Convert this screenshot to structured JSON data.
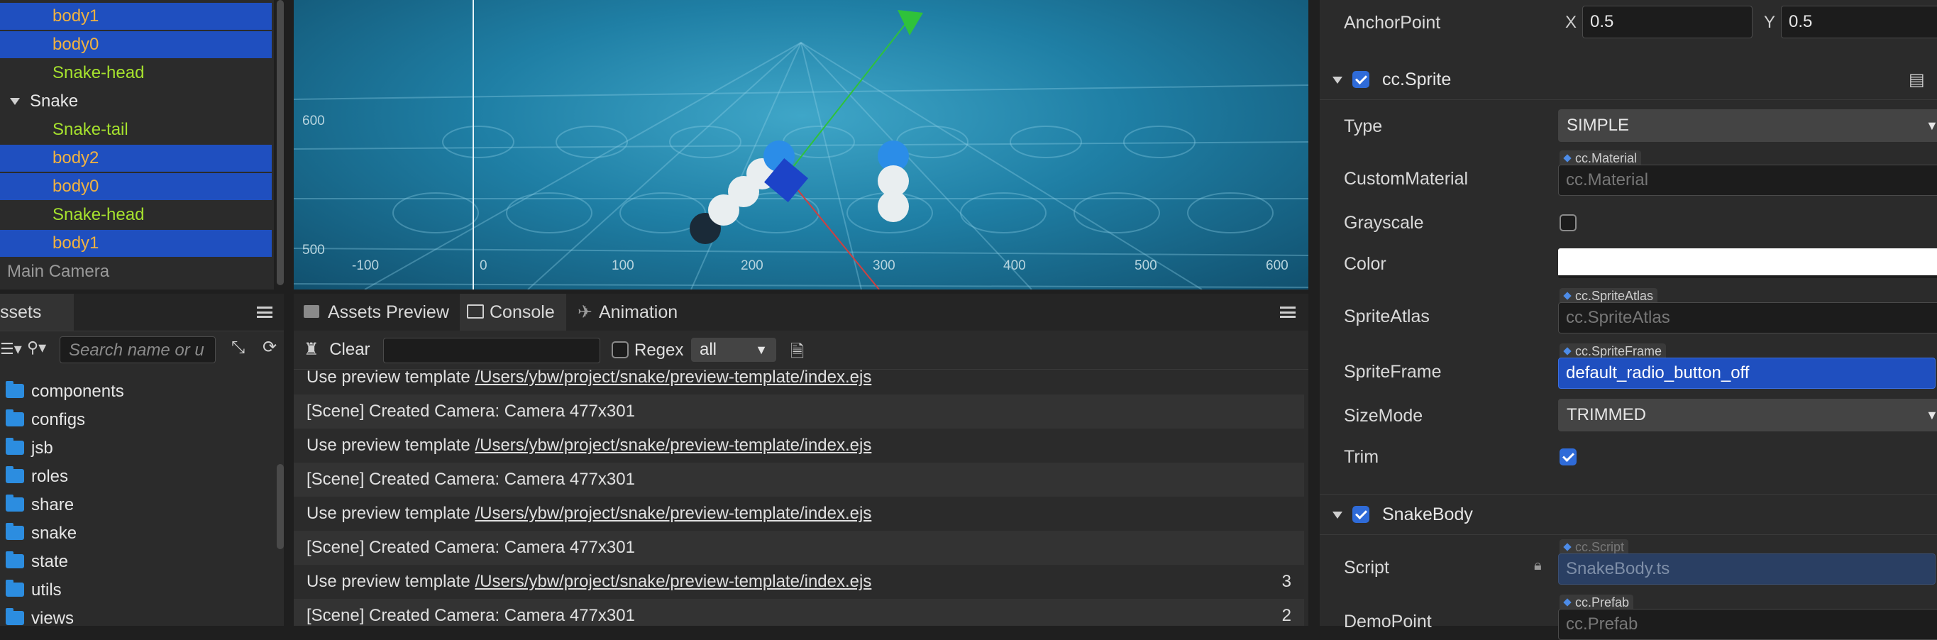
{
  "hierarchy": {
    "items": [
      {
        "label": "body1",
        "color": "orange"
      },
      {
        "label": "body0",
        "color": "orange"
      },
      {
        "label": "Snake-head",
        "color": "green"
      },
      {
        "label": "Snake",
        "color": "white"
      },
      {
        "label": "Snake-tail",
        "color": "green"
      },
      {
        "label": "body2",
        "color": "orange"
      },
      {
        "label": "body0",
        "color": "orange"
      },
      {
        "label": "Snake-head",
        "color": "green"
      },
      {
        "label": "body1",
        "color": "orange"
      },
      {
        "label": "Main Camera",
        "color": "gray"
      }
    ]
  },
  "scene": {
    "y_labels": [
      "600",
      "500"
    ],
    "x_labels": [
      "-100",
      "0",
      "100",
      "200",
      "300",
      "400",
      "500",
      "600"
    ]
  },
  "assets": {
    "tab_label": "ssets",
    "search_placeholder": "Search name or u",
    "folders": [
      "components",
      "configs",
      "jsb",
      "roles",
      "share",
      "snake",
      "state",
      "utils",
      "views"
    ]
  },
  "bottom_tabs": {
    "assets_preview": "Assets Preview",
    "console": "Console",
    "animation": "Animation"
  },
  "console": {
    "clear_label": "Clear",
    "regex_label": "Regex",
    "filter_value": "all",
    "logs": [
      {
        "prefix": "Use preview template ",
        "link": "/Users/ybw/project/snake/preview-template/index.ejs",
        "count": ""
      },
      {
        "prefix": "[Scene] Created Camera: Camera 477x301",
        "link": "",
        "count": ""
      },
      {
        "prefix": "Use preview template ",
        "link": "/Users/ybw/project/snake/preview-template/index.ejs",
        "count": ""
      },
      {
        "prefix": "[Scene] Created Camera: Camera 477x301",
        "link": "",
        "count": ""
      },
      {
        "prefix": "Use preview template ",
        "link": "/Users/ybw/project/snake/preview-template/index.ejs",
        "count": ""
      },
      {
        "prefix": "[Scene] Created Camera: Camera 477x301",
        "link": "",
        "count": ""
      },
      {
        "prefix": "Use preview template ",
        "link": "/Users/ybw/project/snake/preview-template/index.ejs",
        "count": "3"
      },
      {
        "prefix": "[Scene] Created Camera: Camera 477x301",
        "link": "",
        "count": "2"
      }
    ]
  },
  "inspector": {
    "anchor_label": "AnchorPoint",
    "anchor_x_label": "X",
    "anchor_x": "0.5",
    "anchor_y_label": "Y",
    "anchor_y": "0.5",
    "sprite_section": "cc.Sprite",
    "type_label": "Type",
    "type_value": "SIMPLE",
    "custom_material_label": "CustomMaterial",
    "custom_material_tag": "cc.Material",
    "custom_material_value": "cc.Material",
    "grayscale_label": "Grayscale",
    "color_label": "Color",
    "sprite_atlas_label": "SpriteAtlas",
    "sprite_atlas_tag": "cc.SpriteAtlas",
    "sprite_atlas_value": "cc.SpriteAtlas",
    "sprite_frame_label": "SpriteFrame",
    "sprite_frame_tag": "cc.SpriteFrame",
    "sprite_frame_value": "default_radio_button_off",
    "size_mode_label": "SizeMode",
    "size_mode_value": "TRIMMED",
    "trim_label": "Trim",
    "snake_body_section": "SnakeBody",
    "script_label": "Script",
    "script_tag": "cc.Script",
    "script_value": "SnakeBody.ts",
    "demo_point_label": "DemoPoint",
    "demo_point_tag": "cc.Prefab",
    "demo_point_value": "cc.Prefab"
  },
  "colors": {
    "selection": "#1f4fbf",
    "accent": "#2f6bd8",
    "node_orange": "#f1b241",
    "node_green": "#a6e22e"
  }
}
